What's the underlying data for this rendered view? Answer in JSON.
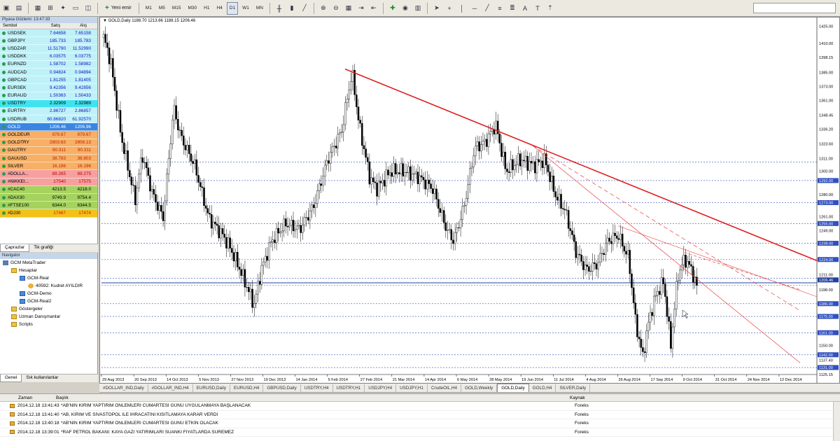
{
  "toolbar": {
    "new_order_label": "Yeni emir",
    "timeframes": [
      "M1",
      "M5",
      "M15",
      "M30",
      "H1",
      "H4",
      "D1",
      "W1",
      "MN"
    ],
    "active_timeframe": "D1"
  },
  "market_watch": {
    "title": "Piyasa Gözlemi: 13:47:33",
    "columns": [
      "Sembol",
      "Satış",
      "Alış"
    ],
    "rows": [
      {
        "symbol": "USDSEK",
        "bid": "7.64658",
        "ask": "7.65158",
        "style": "cyan"
      },
      {
        "symbol": "GBPJPY",
        "bid": "185.733",
        "ask": "185.783",
        "style": "cyan"
      },
      {
        "symbol": "USDZAR",
        "bid": "11.51790",
        "ask": "11.52990",
        "style": "cyan"
      },
      {
        "symbol": "USDDKK",
        "bid": "6.03575",
        "ask": "6.03775",
        "style": "cyan"
      },
      {
        "symbol": "EURNZD",
        "bid": "1.58702",
        "ask": "1.58982",
        "style": "cyan"
      },
      {
        "symbol": "AUDCAD",
        "bid": "0.94824",
        "ask": "0.94894",
        "style": "cyan"
      },
      {
        "symbol": "GBPCAD",
        "bid": "1.81255",
        "ask": "1.81405",
        "style": "cyan"
      },
      {
        "symbol": "EURSEK",
        "bid": "9.42356",
        "ask": "9.42856",
        "style": "cyan"
      },
      {
        "symbol": "EURAUD",
        "bid": "1.50363",
        "ask": "1.50433",
        "style": "cyan"
      },
      {
        "symbol": "USDTRY",
        "bid": "2.32909",
        "ask": "2.32989",
        "style": "hl-cyan"
      },
      {
        "symbol": "EURTRY",
        "bid": "2.86727",
        "ask": "2.86857",
        "style": "cyan"
      },
      {
        "symbol": "USDRUB",
        "bid": "60.86820",
        "ask": "61.92570",
        "style": "cyan"
      },
      {
        "symbol": "GOLD",
        "bid": "1206.46",
        "ask": "1206.96",
        "style": "blue"
      },
      {
        "symbol": "GOLDEUR",
        "bid": "978.67",
        "ask": "979.67",
        "style": "orange"
      },
      {
        "symbol": "GOLDTRY",
        "bid": "2803.63",
        "ask": "2808.13",
        "style": "orange"
      },
      {
        "symbol": "GAUTRY",
        "bid": "90.311",
        "ask": "90.311",
        "style": "orange"
      },
      {
        "symbol": "GAUUSD",
        "bid": "38.783",
        "ask": "38.803",
        "style": "orange"
      },
      {
        "symbol": "SILVER",
        "bid": "16.196",
        "ask": "16.196",
        "style": "orange"
      },
      {
        "symbol": "#DOLLA...",
        "bid": "89.265",
        "ask": "89.275",
        "style": "pink"
      },
      {
        "symbol": "#NIKKEI...",
        "bid": "17540",
        "ask": "17575",
        "style": "pink"
      },
      {
        "symbol": "#CAC40",
        "bid": "4213.5",
        "ask": "4218.0",
        "style": "green"
      },
      {
        "symbol": "#DAX30",
        "bid": "9749.9",
        "ask": "9754.4",
        "style": "green"
      },
      {
        "symbol": "#FTSE100",
        "bid": "6344.0",
        "ask": "6344.5",
        "style": "green"
      },
      {
        "symbol": "#DJ30",
        "bid": "17467",
        "ask": "17474",
        "style": "yellow"
      }
    ],
    "tabs": [
      "Çaprazlar",
      "Tik grafiği"
    ]
  },
  "navigator": {
    "title": "Navigator",
    "items": [
      {
        "label": "GCM MetaTrader",
        "level": 0,
        "icon": "app-icon"
      },
      {
        "label": "Hesaplar",
        "level": 1,
        "icon": "folder-icon"
      },
      {
        "label": "GCM-Real",
        "level": 2,
        "icon": "account-icon"
      },
      {
        "label": "40592: Kudret AYILDIR",
        "level": 3,
        "icon": "user-icon"
      },
      {
        "label": "GCM-Demo",
        "level": 2,
        "icon": "account-icon"
      },
      {
        "label": "GCM-Real2",
        "level": 2,
        "icon": "account-icon"
      },
      {
        "label": "Göstergeler",
        "level": 1,
        "icon": "folder-icon"
      },
      {
        "label": "Uzman Danışmanlar",
        "level": 1,
        "icon": "folder-icon"
      },
      {
        "label": "Scripts",
        "level": 1,
        "icon": "folder-icon"
      }
    ],
    "tabs": [
      "Genel",
      "Sık kullanılanlar"
    ]
  },
  "chart": {
    "info": "GOLD,Daily  1188.70 1213.66 1188.15 1206.46",
    "colors": {
      "trend_main": "#e02020",
      "trend_thin": "#e84040",
      "hline": "#3050c0",
      "bid_line": "#2040a0"
    },
    "x_labels": [
      "29 Aug 2013",
      "20 Sep 2013",
      "14 Oct 2013",
      "5 Nov 2013",
      "27 Nov 2013",
      "19 Dec 2013",
      "14 Jan 2014",
      "5 Feb 2014",
      "27 Feb 2014",
      "21 Mar 2014",
      "14 Apr 2014",
      "6 May 2014",
      "28 May 2014",
      "19 Jun 2014",
      "11 Jul 2014",
      "4 Aug 2014",
      "26 Aug 2014",
      "17 Sep 2014",
      "9 Oct 2014",
      "31 Oct 2014",
      "24 Nov 2014",
      "12 Dec 2014"
    ],
    "y_labels": [
      "1425.00",
      "1410.00",
      "1398.15",
      "1385.00",
      "1373.00",
      "1361.00",
      "1348.45",
      "1336.20",
      "1323.60",
      "1311.00",
      "1300.00",
      "1292.00",
      "1280.00",
      "1273.00",
      "1261.00",
      "1255.00",
      "1249.00",
      "1238.00",
      "1224.00",
      "1211.00",
      "1206.46",
      "1198.00",
      "1186.00",
      "1175.00",
      "1161.00",
      "1150.00",
      "1142.00",
      "1137.40",
      "1131.00",
      "1125.15"
    ],
    "highlighted_levels": [
      "1308.00",
      "1292.00",
      "1273.00",
      "1255.00",
      "1238.00",
      "1224.00",
      "1208.00",
      "1202.00",
      "1186.00",
      "1175.00",
      "1161.00",
      "1142.00",
      "1131.00"
    ]
  },
  "chart_tabs": {
    "items": [
      "#DOLLAR_IND,Daily",
      "#DOLLAR_IND,H4",
      "EURUSD,Daily",
      "EURUSD,H4",
      "GBPUSD,Daily",
      "USDTRY,H4",
      "USDTRY,H1",
      "USDJPY,H4",
      "USDJPY,H1",
      "CrudeOIL,H4",
      "GOLD,Weekly",
      "GOLD,Daily",
      "GOLD,H4",
      "SILVER,Daily"
    ],
    "active": "GOLD,Daily"
  },
  "news": {
    "columns": [
      "Zaman",
      "Başlık",
      "Kaynak"
    ],
    "rows": [
      {
        "time": "2014.12.18 13:41:43",
        "title": "*AB'NİN KIRIM YAPTIRIM ÖNLEMLERİ CUMARTESİ GÜNÜ UYGULANMAYA BAŞLANACAK",
        "source": "Foreks"
      },
      {
        "time": "2014.12.18 13:41:40",
        "title": "*AB, KIRIM VE SİVASTOPOL İLE İHRACATINI KISITLAMAYA KARAR VERDİ",
        "source": "Foreks"
      },
      {
        "time": "2014.12.18 13:40:18",
        "title": "*AB'NİN KIRIM YAPTIRIM ÖNLEMLERİ CUMARTESİ GÜNÜ ETKİN OLACAK",
        "source": "Foreks"
      },
      {
        "time": "2014.12.18 13:39:01",
        "title": "*RAF PETROL BAKANI: KAYA GAZI YATIRIMLARI SUANKI FIYATLARDA SÜREMEZ",
        "source": "Foreks"
      }
    ]
  }
}
